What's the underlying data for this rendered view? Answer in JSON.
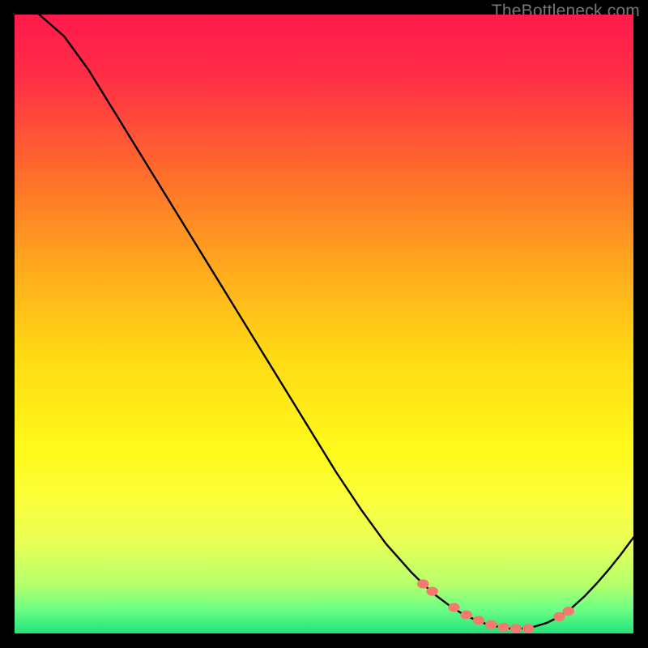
{
  "attribution": "TheBottleneck.com",
  "chart_data": {
    "type": "line",
    "title": "",
    "xlabel": "",
    "ylabel": "",
    "xlim": [
      0,
      100
    ],
    "ylim": [
      0,
      100
    ],
    "grid": false,
    "legend": false,
    "series": [
      {
        "name": "curve",
        "x": [
          0,
          4,
          8,
          12,
          16,
          20,
          24,
          28,
          32,
          36,
          40,
          44,
          48,
          52,
          56,
          60,
          64,
          66,
          68,
          70,
          72,
          74,
          76,
          78,
          80,
          82,
          84,
          86,
          88,
          90,
          92,
          94,
          96,
          98,
          100
        ],
        "y": [
          103,
          100,
          96.5,
          91,
          84.5,
          78,
          71.5,
          65,
          58.5,
          52,
          45.5,
          39,
          32.5,
          26,
          20,
          14.5,
          10,
          8,
          6.2,
          4.7,
          3.4,
          2.4,
          1.6,
          1.1,
          0.8,
          0.8,
          1.1,
          1.7,
          2.7,
          4.1,
          5.9,
          8.0,
          10.3,
          12.8,
          15.5
        ]
      },
      {
        "name": "markers",
        "x": [
          66,
          67.5,
          71,
          73,
          75,
          77,
          79,
          81,
          83,
          88,
          89.5
        ],
        "y": [
          8,
          6.8,
          4.2,
          3.0,
          2.1,
          1.4,
          1.0,
          0.8,
          0.8,
          2.7,
          3.6
        ]
      }
    ],
    "gradient_stops": [
      {
        "t": 0.0,
        "color": "#ff1a4b"
      },
      {
        "t": 0.1,
        "color": "#ff2e46"
      },
      {
        "t": 0.25,
        "color": "#ff6a2c"
      },
      {
        "t": 0.4,
        "color": "#ffa61e"
      },
      {
        "t": 0.55,
        "color": "#ffd914"
      },
      {
        "t": 0.7,
        "color": "#fff91a"
      },
      {
        "t": 0.78,
        "color": "#fbff3a"
      },
      {
        "t": 0.85,
        "color": "#eaff55"
      },
      {
        "t": 0.92,
        "color": "#b6ff6b"
      },
      {
        "t": 0.96,
        "color": "#6dff84"
      },
      {
        "t": 1.0,
        "color": "#22e27b"
      }
    ],
    "marker_color": "#f47a6e",
    "curve_color": "#000000"
  }
}
